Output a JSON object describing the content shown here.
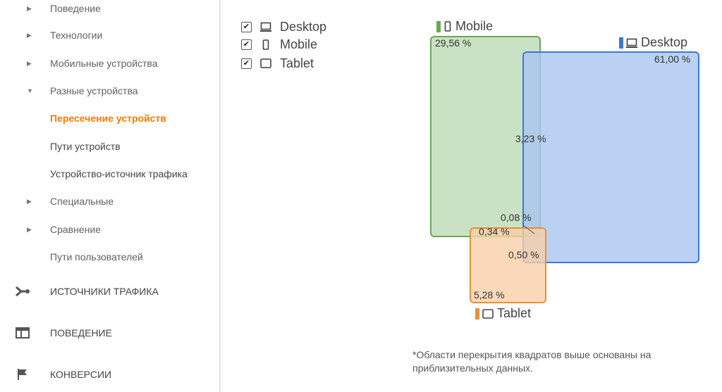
{
  "sidebar": {
    "items": [
      {
        "label": "Поведение",
        "kind": "collapsed"
      },
      {
        "label": "Технологии",
        "kind": "collapsed"
      },
      {
        "label": "Мобильные устройства",
        "kind": "collapsed"
      },
      {
        "label": "Разные устройства",
        "kind": "expanded"
      },
      {
        "label": "Пересечение устройств",
        "kind": "active"
      },
      {
        "label": "Пути устройств",
        "kind": "sub"
      },
      {
        "label": "Устройство-источник трафика",
        "kind": "sub"
      },
      {
        "label": "Специальные",
        "kind": "collapsed"
      },
      {
        "label": "Сравнение",
        "kind": "collapsed"
      },
      {
        "label": "Пути пользователей",
        "kind": "plain"
      }
    ],
    "sections": [
      {
        "label": "ИСТОЧНИКИ ТРАФИКА",
        "icon": "traffic-sources-icon"
      },
      {
        "label": "ПОВЕДЕНИЕ",
        "icon": "behavior-icon"
      },
      {
        "label": "КОНВЕРСИИ",
        "icon": "flag-icon"
      }
    ]
  },
  "filters": [
    {
      "label": "Desktop",
      "checked": true,
      "icon": "desktop-icon"
    },
    {
      "label": "Mobile",
      "checked": true,
      "icon": "mobile-icon"
    },
    {
      "label": "Tablet",
      "checked": true,
      "icon": "tablet-icon"
    }
  ],
  "venn": {
    "series": {
      "mobile": {
        "name": "Mobile",
        "color": "#6aa84f",
        "fill": "#c6e0c0",
        "value": "29,56 %"
      },
      "desktop": {
        "name": "Desktop",
        "color": "#3c78d8",
        "fill": "#b7cff2",
        "value": "61,00 %"
      },
      "tablet": {
        "name": "Tablet",
        "color": "#e69138",
        "fill": "#f8cfa8",
        "value": "5,28 %"
      }
    },
    "overlaps": {
      "mobile_desktop": "3,23 %",
      "all_three": "0,08 %",
      "mobile_tablet": "0,34 %",
      "desktop_tablet": "0,50 %"
    }
  },
  "footnote": "*Области перекрытия квадратов выше основаны на приблизительных данных.",
  "colors": {
    "active_nav": "#f57c00",
    "mobile": "#6aa84f",
    "desktop": "#3c78d8",
    "tablet": "#e69138"
  }
}
